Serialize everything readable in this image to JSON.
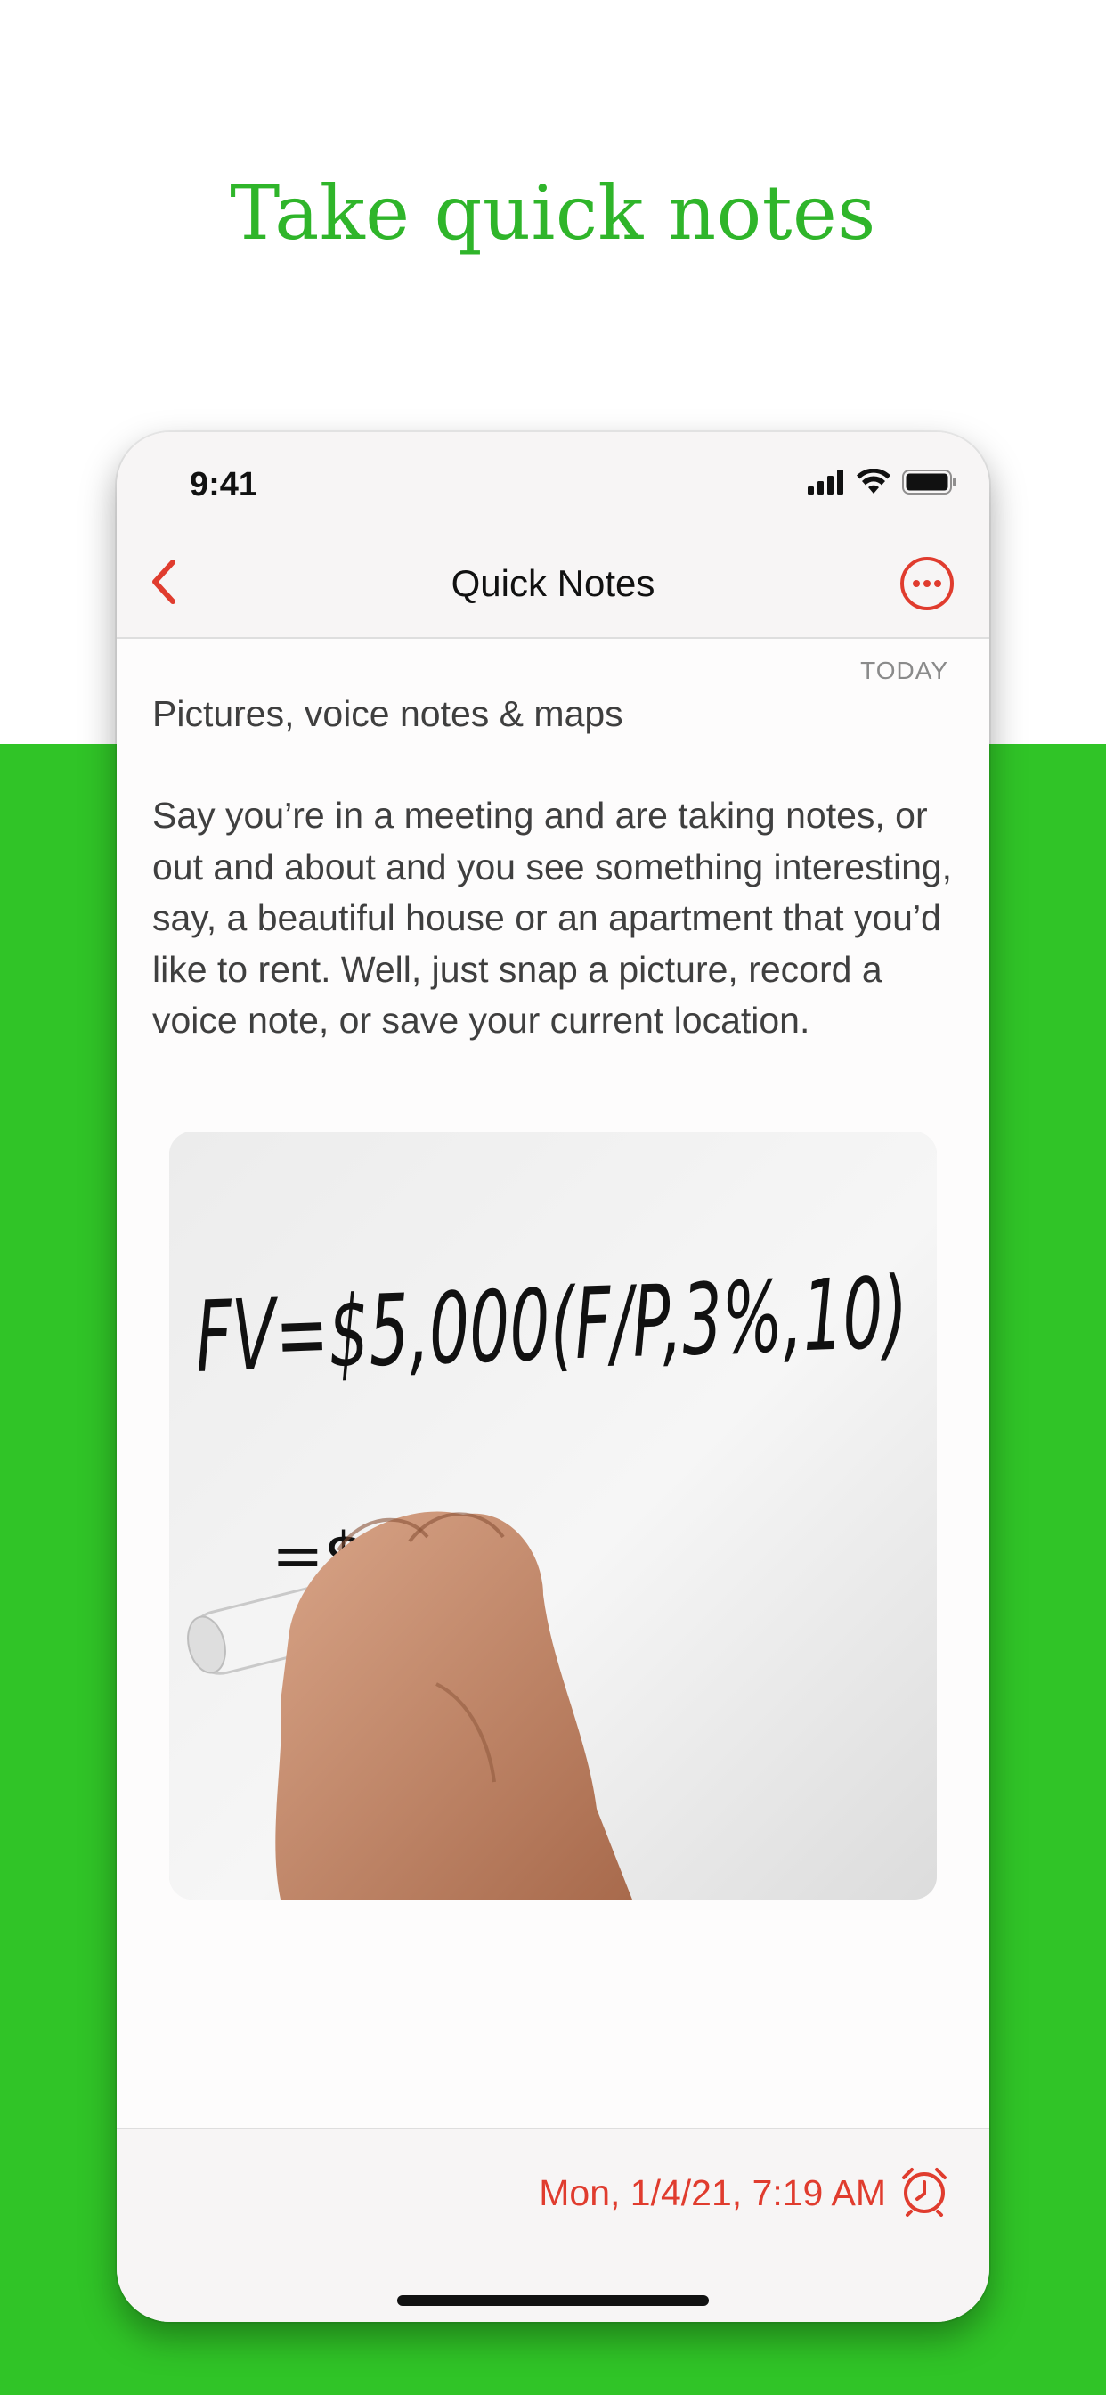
{
  "headline": "Take quick notes",
  "status_bar": {
    "time": "9:41"
  },
  "nav": {
    "title": "Quick Notes"
  },
  "note": {
    "date_label": "TODAY",
    "title": "Pictures, voice notes & maps",
    "body": "Say you’re in a meeting and are taking notes, or out and about and you see something interesting, say, a beautiful house or an apartment that you’d like to rent. Well, just snap a picture, record a voice note, or save your current location.",
    "image": {
      "formula": "FV=$5,000(F/P,3%,10)",
      "partial": "=$"
    }
  },
  "reminder": {
    "text": "Mon, 1/4/21, 7:19 AM"
  },
  "colors": {
    "accent_green": "#30c427",
    "headline_green": "#2fb52a",
    "accent_red": "#e03c2e"
  },
  "icons": {
    "back": "chevron-left-icon",
    "more": "ellipsis-circle-icon",
    "alarm": "alarm-clock-icon",
    "signal": "cellular-signal-icon",
    "wifi": "wifi-icon",
    "battery": "battery-icon"
  }
}
